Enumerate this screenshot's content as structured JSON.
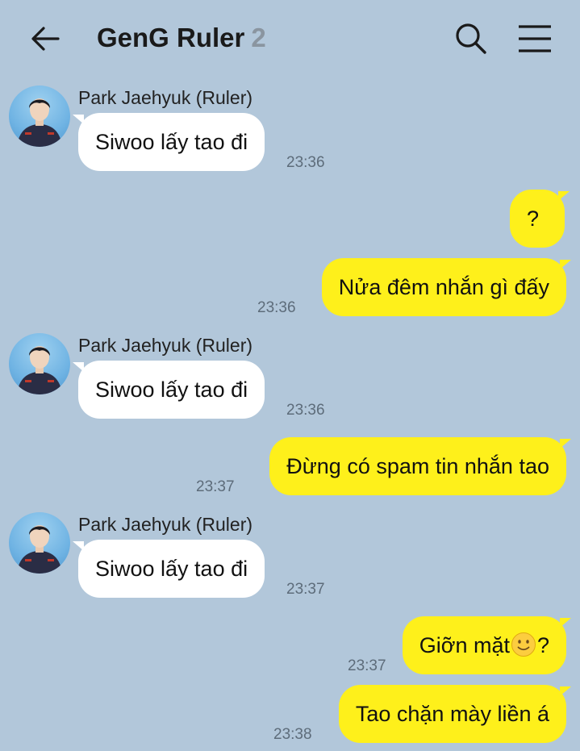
{
  "header": {
    "title": "GenG Ruler",
    "member_count": "2",
    "back_icon": "arrow-left-icon",
    "search_icon": "search-icon",
    "menu_icon": "hamburger-menu-icon"
  },
  "messages": [
    {
      "direction": "in",
      "sender": "Park Jaehyuk (Ruler)",
      "text": "Siwoo lấy tao đi",
      "time": "23:36"
    },
    {
      "direction": "out",
      "text": "?",
      "time": ""
    },
    {
      "direction": "out",
      "text": "Nửa đêm nhắn gì đấy",
      "time": "23:36"
    },
    {
      "direction": "in",
      "sender": "Park Jaehyuk (Ruler)",
      "text": "Siwoo lấy tao đi",
      "time": "23:36"
    },
    {
      "direction": "out",
      "text": "Đừng có spam tin nhắn tao",
      "time": "23:37"
    },
    {
      "direction": "in",
      "sender": "Park Jaehyuk (Ruler)",
      "text": "Siwoo lấy tao đi",
      "time": "23:37"
    },
    {
      "direction": "out",
      "text_before": "Giỡn mặt",
      "emoji": "slightly-smiling-face-emoji",
      "text_after": "?",
      "time": "23:37"
    },
    {
      "direction": "out",
      "text": "Tao chặn mày liền á",
      "time": "23:38"
    }
  ],
  "colors": {
    "background": "#b2c7da",
    "outgoing_bubble": "#fef01b",
    "incoming_bubble": "#ffffff"
  }
}
